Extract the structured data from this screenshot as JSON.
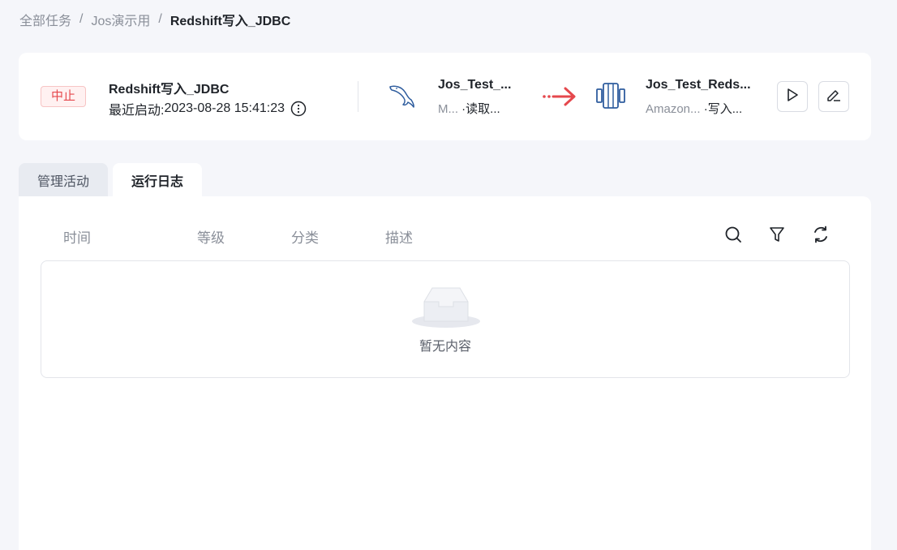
{
  "breadcrumb": {
    "items": [
      "全部任务",
      "Jos演示用"
    ],
    "current": "Redshift写入_JDBC",
    "separator": "/"
  },
  "task": {
    "status": "中止",
    "name": "Redshift写入_JDBC",
    "last_start_label": "最近启动:",
    "last_start_time": "2023-08-28 15:41:23"
  },
  "source": {
    "name": "Jos_Test_...",
    "type": "M...",
    "action": "·读取..."
  },
  "destination": {
    "name": "Jos_Test_Reds...",
    "type": "Amazon...",
    "action": "·写入..."
  },
  "tabs": [
    {
      "label": "管理活动",
      "active": false
    },
    {
      "label": "运行日志",
      "active": true
    }
  ],
  "log_table": {
    "columns": [
      "时间",
      "等级",
      "分类",
      "描述"
    ],
    "empty_text": "暂无内容"
  },
  "colors": {
    "status_red": "#e5484d",
    "arrow_red": "#e5484d",
    "icon_blue": "#2f5d9e"
  },
  "icons": [
    "info-icon",
    "mysql-icon",
    "redshift-icon",
    "play-icon",
    "edit-icon",
    "search-icon",
    "filter-icon",
    "refresh-icon"
  ]
}
